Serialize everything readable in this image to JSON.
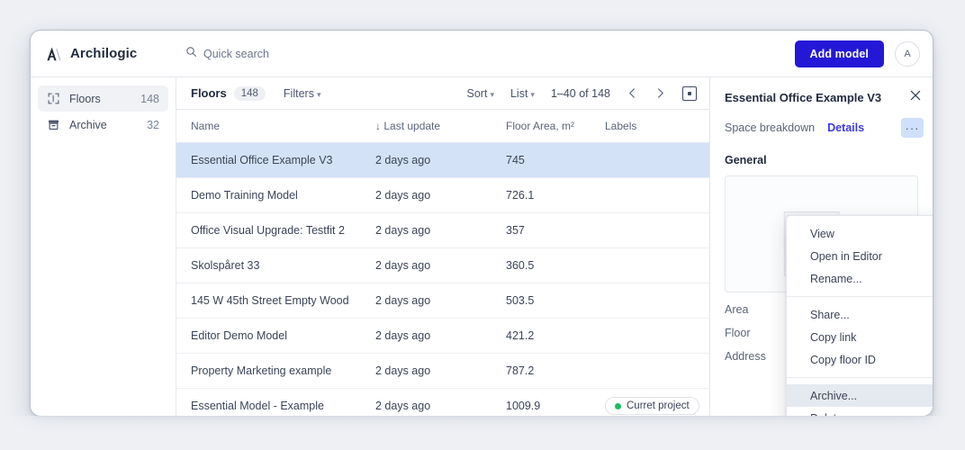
{
  "topbar": {
    "brand": "Archilogic",
    "search_placeholder": "Quick search",
    "search_value": "",
    "add_model_label": "Add model",
    "avatar_initial": "A"
  },
  "sidebar": {
    "items": [
      {
        "label": "Floors",
        "count": "148",
        "icon": "floor-plan-icon",
        "active": true
      },
      {
        "label": "Archive",
        "count": "32",
        "icon": "archive-box-icon",
        "active": false
      }
    ]
  },
  "list_toolbar": {
    "title": "Floors",
    "count": "148",
    "filters_label": "Filters",
    "sort_label": "Sort",
    "view_label": "List",
    "range_label": "1–40 of 148"
  },
  "table": {
    "columns": [
      "Name",
      "Last update",
      "Floor Area, m²",
      "Labels"
    ],
    "sort_indicator": "↓",
    "sorted_column_index": 1,
    "rows": [
      {
        "name": "Essential Office Example V3",
        "updated": "2 days ago",
        "area": "745",
        "label": "",
        "selected": true
      },
      {
        "name": "Demo Training Model",
        "updated": "2 days ago",
        "area": "726.1",
        "label": "",
        "selected": false
      },
      {
        "name": "Office Visual Upgrade: Testfit 2",
        "updated": "2 days ago",
        "area": "357",
        "label": "",
        "selected": false
      },
      {
        "name": "Skolspåret 33",
        "updated": "2 days ago",
        "area": "360.5",
        "label": "",
        "selected": false
      },
      {
        "name": "145 W 45th Street Empty Wood",
        "updated": "2 days ago",
        "area": "503.5",
        "label": "",
        "selected": false
      },
      {
        "name": "Editor Demo Model",
        "updated": "2 days ago",
        "area": "421.2",
        "label": "",
        "selected": false
      },
      {
        "name": "Property Marketing example",
        "updated": "2 days ago",
        "area": "787.2",
        "label": "",
        "selected": false
      },
      {
        "name": "Essential Model - Example",
        "updated": "2 days ago",
        "area": "1009.9",
        "label": "Curret project",
        "selected": false
      }
    ]
  },
  "detail_panel": {
    "title": "Essential Office Example V3",
    "tab_space_breakdown": "Space breakdown",
    "tab_details": "Details",
    "more_label": "···",
    "section_general": "General",
    "fields": [
      {
        "label": "Area"
      },
      {
        "label": "Floor"
      },
      {
        "label": "Address"
      }
    ]
  },
  "context_menu": {
    "groups": [
      [
        {
          "label": "View",
          "hover": false
        },
        {
          "label": "Open in Editor",
          "hover": false
        },
        {
          "label": "Rename...",
          "hover": false
        }
      ],
      [
        {
          "label": "Share...",
          "hover": false
        },
        {
          "label": "Copy link",
          "hover": false
        },
        {
          "label": "Copy floor ID",
          "hover": false
        }
      ],
      [
        {
          "label": "Archive...",
          "hover": true
        },
        {
          "label": "Delete...",
          "hover": false
        }
      ]
    ]
  },
  "colors": {
    "accent": "#2418d6",
    "link": "#3b38e8",
    "selected_row": "#d4e2f7",
    "status_green": "#1dbf5c",
    "page_bg": "#eef0f4"
  }
}
